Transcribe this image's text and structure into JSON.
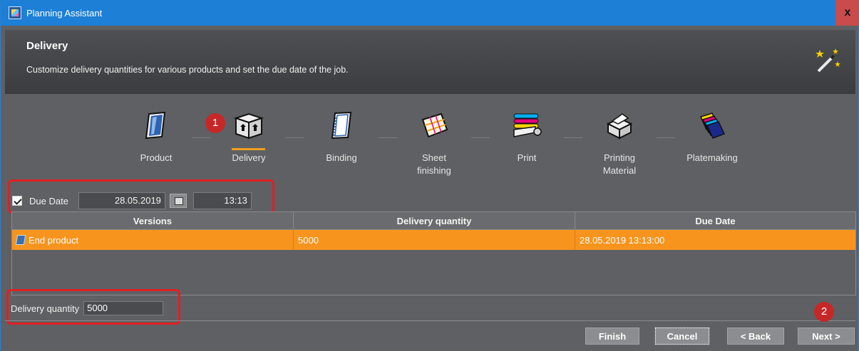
{
  "window": {
    "title": "Planning Assistant",
    "close_label": "x"
  },
  "header": {
    "title": "Delivery",
    "subtitle": "Customize delivery quantities for various products and set the due date of the job."
  },
  "steps": [
    {
      "label": "Product",
      "icon": "product-icon"
    },
    {
      "label": "Delivery",
      "icon": "delivery-box-icon",
      "active": true
    },
    {
      "label": "Binding",
      "icon": "binding-icon"
    },
    {
      "label_line1": "Sheet",
      "label_line2": "finishing",
      "icon": "sheet-finishing-icon"
    },
    {
      "label": "Print",
      "icon": "print-rollers-icon"
    },
    {
      "label_line1": "Printing",
      "label_line2": "Material",
      "icon": "printing-material-icon"
    },
    {
      "label": "Platemaking",
      "icon": "platemaking-icon"
    }
  ],
  "badges": {
    "one": "1",
    "two": "2"
  },
  "due_date": {
    "checked": true,
    "label": "Due Date",
    "date": "28.05.2019",
    "time": "13:13"
  },
  "table": {
    "columns": [
      "Versions",
      "Delivery quantity",
      "Due Date"
    ],
    "rows": [
      {
        "version": "End product",
        "quantity": "5000",
        "due_date": "28.05.2019 13:13:00"
      }
    ]
  },
  "delivery_quantity": {
    "label": "Delivery quantity",
    "value": "5000"
  },
  "buttons": {
    "finish": "Finish",
    "cancel": "Cancel",
    "back": "< Back",
    "next": "Next >"
  },
  "colors": {
    "title_bar": "#1d7fd6",
    "accent_orange": "#f7941d",
    "highlight_red": "#e01f26"
  }
}
